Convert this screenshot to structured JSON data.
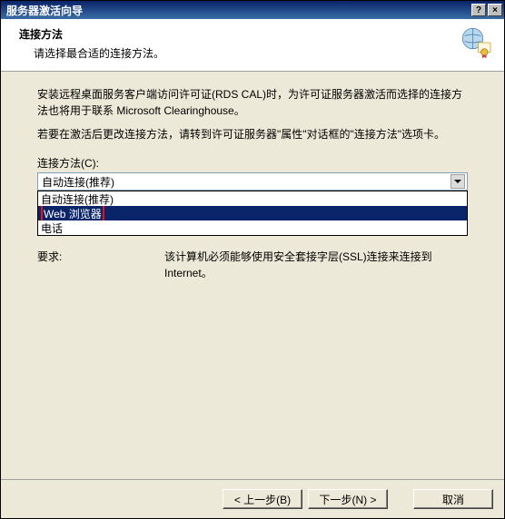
{
  "titlebar": {
    "title": "服务器激活向导",
    "close": "×",
    "help": "?"
  },
  "header": {
    "title": "连接方法",
    "subtitle": "请选择最合适的连接方法。"
  },
  "body": {
    "p1": "安装远程桌面服务客户端访问许可证(RDS CAL)时，为许可证服务器激活而选择的连接方法也将用于联系 Microsoft Clearinghouse。",
    "p2": "若要在激活后更改连接方法，请转到许可证服务器\"属性\"对话框的\"连接方法\"选项卡。",
    "combo_label": "连接方法(C):",
    "combo_selected": "自动连接(推荐)",
    "options": [
      "自动连接(推荐)",
      "Web 浏览器",
      "电话"
    ],
    "req_label": "要求:",
    "req_text": "该计算机必须能够使用安全套接字层(SSL)连接来连接到 Internet。"
  },
  "footer": {
    "back": "< 上一步(B)",
    "next": "下一步(N) >",
    "cancel": "取消"
  }
}
